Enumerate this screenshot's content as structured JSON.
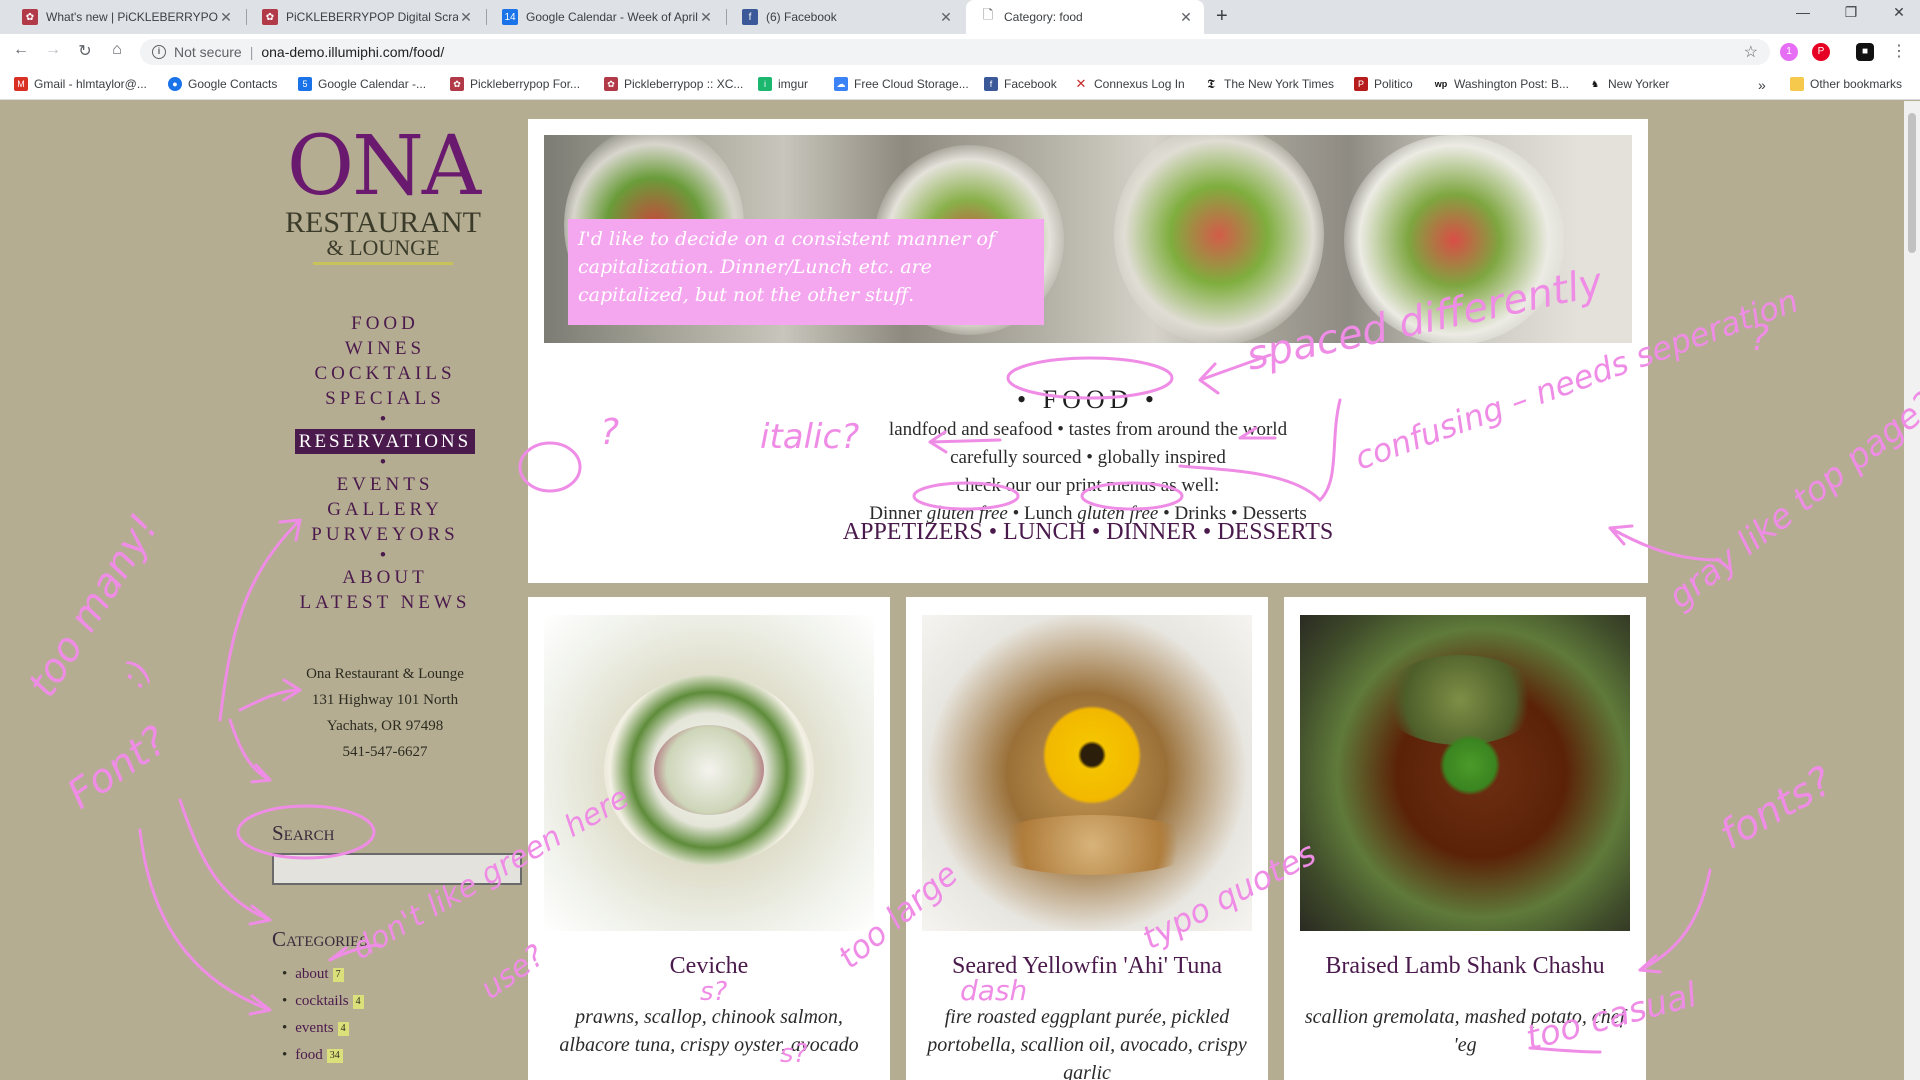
{
  "browser": {
    "tabs": [
      {
        "title": "What's new | PiCKLEBERRYPOP F",
        "active": false
      },
      {
        "title": "PiCKLEBERRYPOP Digital Scrapbo",
        "active": false
      },
      {
        "title": "Google Calendar - Week of April",
        "active": false
      },
      {
        "title": "(6) Facebook",
        "active": false
      },
      {
        "title": "Category: food",
        "active": true
      }
    ],
    "calendar_badge": "14",
    "security_label": "Not secure",
    "url": "ona-demo.illumiphi.com/food/",
    "ext_badge": "1",
    "bookmarks": [
      {
        "label": "Gmail - hlmtaylor@...",
        "icon": "gmail-icon",
        "color": "#d93025"
      },
      {
        "label": "Google Contacts",
        "icon": "contacts-icon",
        "color": "#1a73e8"
      },
      {
        "label": "Google Calendar -...",
        "icon": "calendar-icon",
        "color": "#1a73e8"
      },
      {
        "label": "Pickleberrypop For...",
        "icon": "pickleberry-icon",
        "color": "#b23a48"
      },
      {
        "label": "Pickleberrypop :: XC...",
        "icon": "pickleberry-icon",
        "color": "#b23a48"
      },
      {
        "label": "imgur",
        "icon": "imgur-icon",
        "color": "#1bb76e"
      },
      {
        "label": "Free Cloud Storage...",
        "icon": "cloud-icon",
        "color": "#3b82f6"
      },
      {
        "label": "Facebook",
        "icon": "facebook-icon",
        "color": "#3b5998"
      },
      {
        "label": "Connexus Log In",
        "icon": "connexus-icon",
        "color": "#c62828"
      },
      {
        "label": "The New York Times",
        "icon": "nyt-icon",
        "color": "#111111"
      },
      {
        "label": "Politico",
        "icon": "politico-icon",
        "color": "#b71c1c"
      },
      {
        "label": "Washington Post: B...",
        "icon": "wapo-icon",
        "color": "#111111"
      },
      {
        "label": "New Yorker",
        "icon": "newyorker-icon",
        "color": "#111111"
      }
    ],
    "bookmarks_more": "»",
    "other_bookmarks": "Other bookmarks"
  },
  "sidebar": {
    "logo": {
      "name": "ONA",
      "line2": "RESTAURANT",
      "line3": "& LOUNGE"
    },
    "nav_group1": [
      "FOOD",
      "WINES",
      "COCKTAILS",
      "SPECIALS"
    ],
    "separator": "•",
    "reservations": "RESERVATIONS",
    "nav_group2": [
      "EVENTS",
      "GALLERY",
      "PURVEYORS"
    ],
    "nav_group3": [
      "ABOUT",
      "LATEST NEWS"
    ],
    "address": [
      "Ona Restaurant & Lounge",
      "131 Highway 101 North",
      "Yachats, OR 97498",
      "541-547-6627"
    ],
    "search_heading": "Search",
    "categories_heading": "Categories",
    "categories": [
      {
        "label": "about",
        "count": "7"
      },
      {
        "label": "cocktails",
        "count": "4"
      },
      {
        "label": "events",
        "count": "4"
      },
      {
        "label": "food",
        "count": "34"
      }
    ]
  },
  "main": {
    "hero_note": "I'd like to decide on a consistent manner of capitalization. Dinner/Lunch etc. are capitalized, but not the other stuff.",
    "title": "• FOOD •",
    "tagline1": "landfood and seafood • tastes from around the world",
    "tagline2": "carefully sourced • globally inspired",
    "tagline3": "check our our print menus as well:",
    "print_menus": {
      "dinner": "Dinner",
      "gf": "gluten free",
      "sep": " • ",
      "lunch": "Lunch",
      "drinks": "Drinks",
      "desserts": "Desserts"
    },
    "menus": "APPETIZERS • LUNCH • DINNER • DESSERTS",
    "dishes": [
      {
        "name": "Ceviche",
        "desc": "prawns, scallop, chinook salmon, albacore tuna, crispy oyster, avocado"
      },
      {
        "name": "Seared Yellowfin 'Ahi' Tuna",
        "desc": "fire roasted eggplant purée, pickled portobella, scallion oil, avocado, crispy garlic"
      },
      {
        "name": "Braised Lamb Shank Chashu",
        "desc": "scallion gremolata, mashed potato, chef 'eg"
      }
    ]
  },
  "annotations": {
    "italic": "italic?",
    "spaced": "spaced differently",
    "confusing": "confusing – needs seperation",
    "question1": "?",
    "question2": "?",
    "gray": "gray like top page?",
    "too_many": "too many!",
    "smiley": ":)",
    "font": "Font?",
    "dont_like": "don't like green here",
    "use": "use?",
    "too_large": "too large",
    "dash": "dash",
    "s1": "s?",
    "s2": "s?",
    "typo": "typo quotes",
    "too_casual": "too casual",
    "fonts": "fonts?"
  },
  "colors": {
    "accent": "#4b1a4c",
    "background": "#b5ad92",
    "annotation": "#ef8ce6",
    "note": "#f4a6ee",
    "count_badge": "#dbe07a"
  }
}
